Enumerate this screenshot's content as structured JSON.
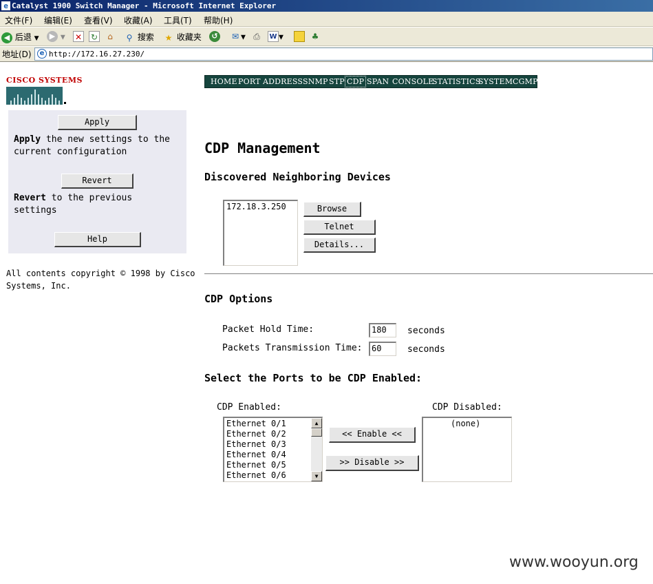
{
  "window": {
    "title": "Catalyst 1900 Switch Manager - Microsoft Internet Explorer"
  },
  "menubar": {
    "items": [
      "文件(F)",
      "编辑(E)",
      "查看(V)",
      "收藏(A)",
      "工具(T)",
      "帮助(H)"
    ]
  },
  "toolbar": {
    "back_label": "后退",
    "search_label": "搜索",
    "favorites_label": "收藏夹"
  },
  "address": {
    "label": "地址(D)",
    "url": "http://172.16.27.230/"
  },
  "logo": {
    "text": "CISCO SYSTEMS"
  },
  "sidebar": {
    "apply_button": "Apply",
    "apply_bold": "Apply",
    "apply_line1": " the new settings to the",
    "apply_line2": "current configuration",
    "revert_button": "Revert",
    "revert_bold": "Revert",
    "revert_line1": " to the previous",
    "revert_line2": "settings",
    "help_button": "Help",
    "copyright_line1": "All contents copyright © 1998 by Cisco",
    "copyright_line2": "Systems, Inc."
  },
  "nav": {
    "items": [
      "HOME",
      "PORT",
      "ADDRESS",
      "SNMP",
      "STP",
      "CDP",
      "SPAN",
      "CONSOLE",
      "STATISTICS",
      "SYSTEM",
      "CGMP"
    ],
    "active": "CDP"
  },
  "main": {
    "title": "CDP Management",
    "neighbors_heading": "Discovered Neighboring Devices",
    "neighbors": [
      "172.18.3.250"
    ],
    "browse_button": "Browse",
    "telnet_button": "Telnet",
    "details_button": "Details...",
    "options_heading": "CDP Options",
    "hold_time_label": "Packet Hold Time:",
    "hold_time_value": "180",
    "hold_time_unit": "seconds",
    "tx_time_label": "Packets Transmission Time:",
    "tx_time_value": "60",
    "tx_time_unit": "seconds",
    "ports_heading": "Select the Ports to be CDP Enabled:",
    "enabled_label": "CDP Enabled:",
    "enabled_ports": [
      "Ethernet 0/1",
      "Ethernet 0/2",
      "Ethernet 0/3",
      "Ethernet 0/4",
      "Ethernet 0/5",
      "Ethernet 0/6"
    ],
    "enable_button": "<< Enable <<",
    "disable_button": ">> Disable >>",
    "disabled_label": "CDP Disabled:",
    "disabled_ports": [
      "(none)"
    ]
  },
  "watermark": "www.wooyun.org"
}
